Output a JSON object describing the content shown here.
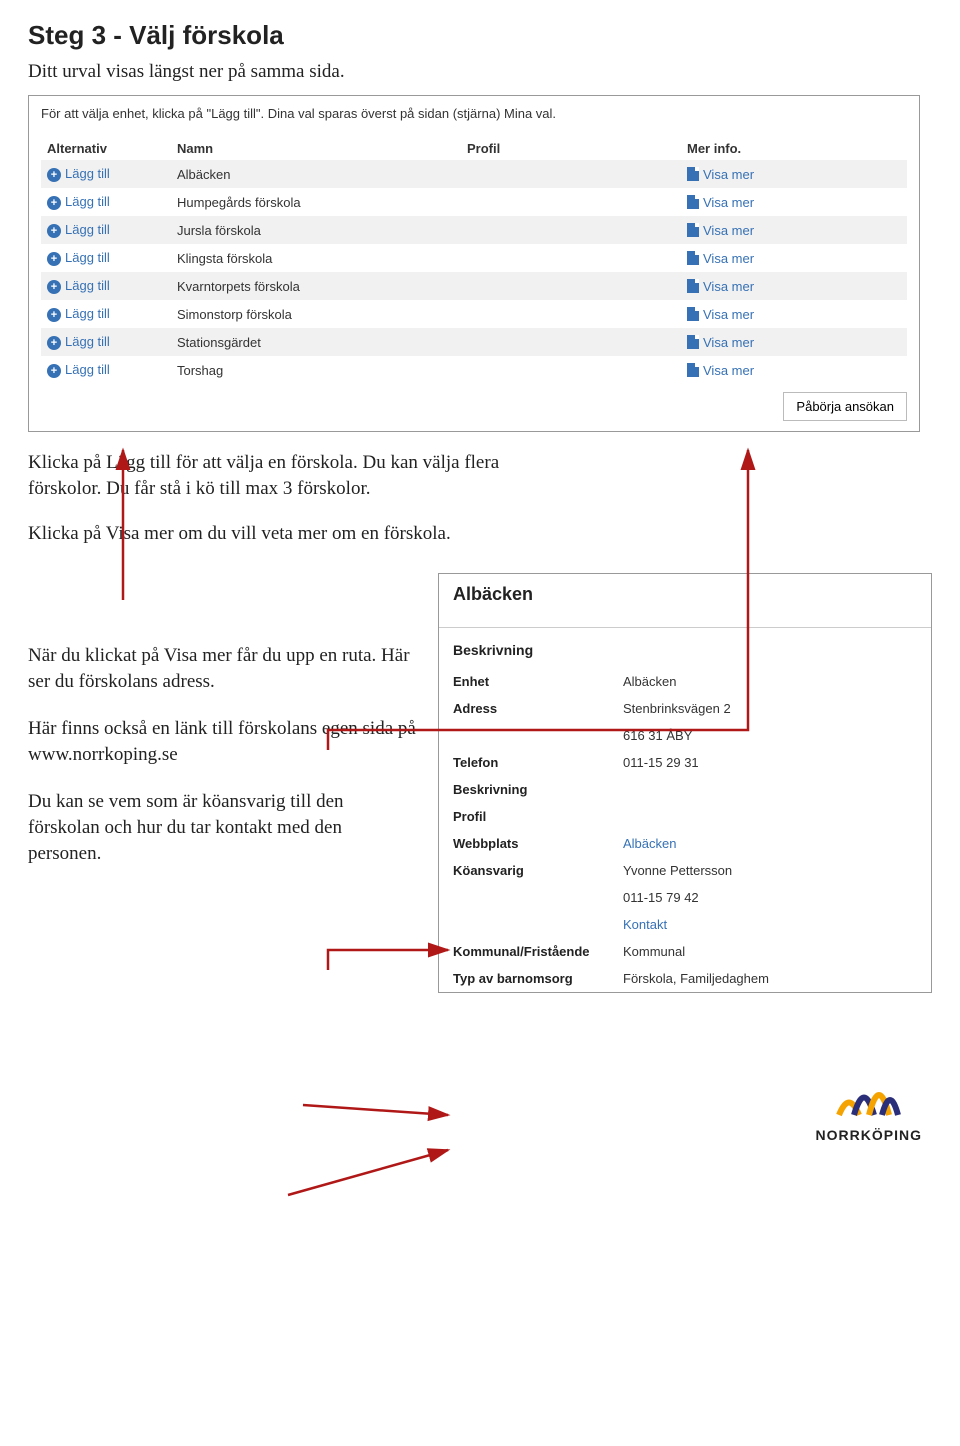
{
  "heading": "Steg 3 - Välj förskola",
  "intro": "Ditt urval visas längst ner på samma sida.",
  "panel": {
    "hint": "För att välja enhet, klicka på \"Lägg till\". Dina val sparas överst på sidan (stjärna) Mina val.",
    "col_alternativ": "Alternativ",
    "col_namn": "Namn",
    "col_profil": "Profil",
    "col_mer": "Mer info.",
    "lagg_till": "Lägg till",
    "visa_mer": "Visa mer",
    "rows": [
      {
        "name": "Albäcken"
      },
      {
        "name": "Humpegårds förskola"
      },
      {
        "name": "Jursla förskola"
      },
      {
        "name": "Klingsta förskola"
      },
      {
        "name": "Kvarntorpets förskola"
      },
      {
        "name": "Simonstorp förskola"
      },
      {
        "name": "Stationsgärdet"
      },
      {
        "name": "Torshag"
      }
    ],
    "start_btn": "Påbörja ansökan"
  },
  "text_lagg": "Klicka på Lägg till för att välja en förskola. Du kan välja flera förskolor. Du får stå i kö till max 3 förskolor.",
  "text_visa": "Klicka på Visa mer om du vill veta mer om en förskola.",
  "text_ruta": "När du klickat på Visa mer får du upp en ruta. Här ser du förskolans adress.",
  "text_lank": "Här finns också en länk till förskolans egen sida på www.norrkoping.se",
  "text_ko": "Du kan se vem som är köansvarig till den förskolan och hur du tar kontakt med den personen.",
  "card": {
    "title": "Albäcken",
    "sub": "Beskrivning",
    "enhet_k": "Enhet",
    "enhet_v": "Albäcken",
    "adress_k": "Adress",
    "adress_v1": "Stenbrinksvägen 2",
    "adress_v2": "616 31 ÅBY",
    "tel_k": "Telefon",
    "tel_v": "011-15 29 31",
    "besk_k": "Beskrivning",
    "profil_k": "Profil",
    "web_k": "Webbplats",
    "web_v": "Albäcken",
    "ko_k": "Köansvarig",
    "ko_v": "Yvonne Pettersson",
    "ko_tel": "011-15 79 42",
    "kontakt_v": "Kontakt",
    "komm_k": "Kommunal/Fristående",
    "komm_v": "Kommunal",
    "typ_k": "Typ av barnomsorg",
    "typ_v": "Förskola, Familjedaghem"
  },
  "logo_text": "NORRKÖPING"
}
